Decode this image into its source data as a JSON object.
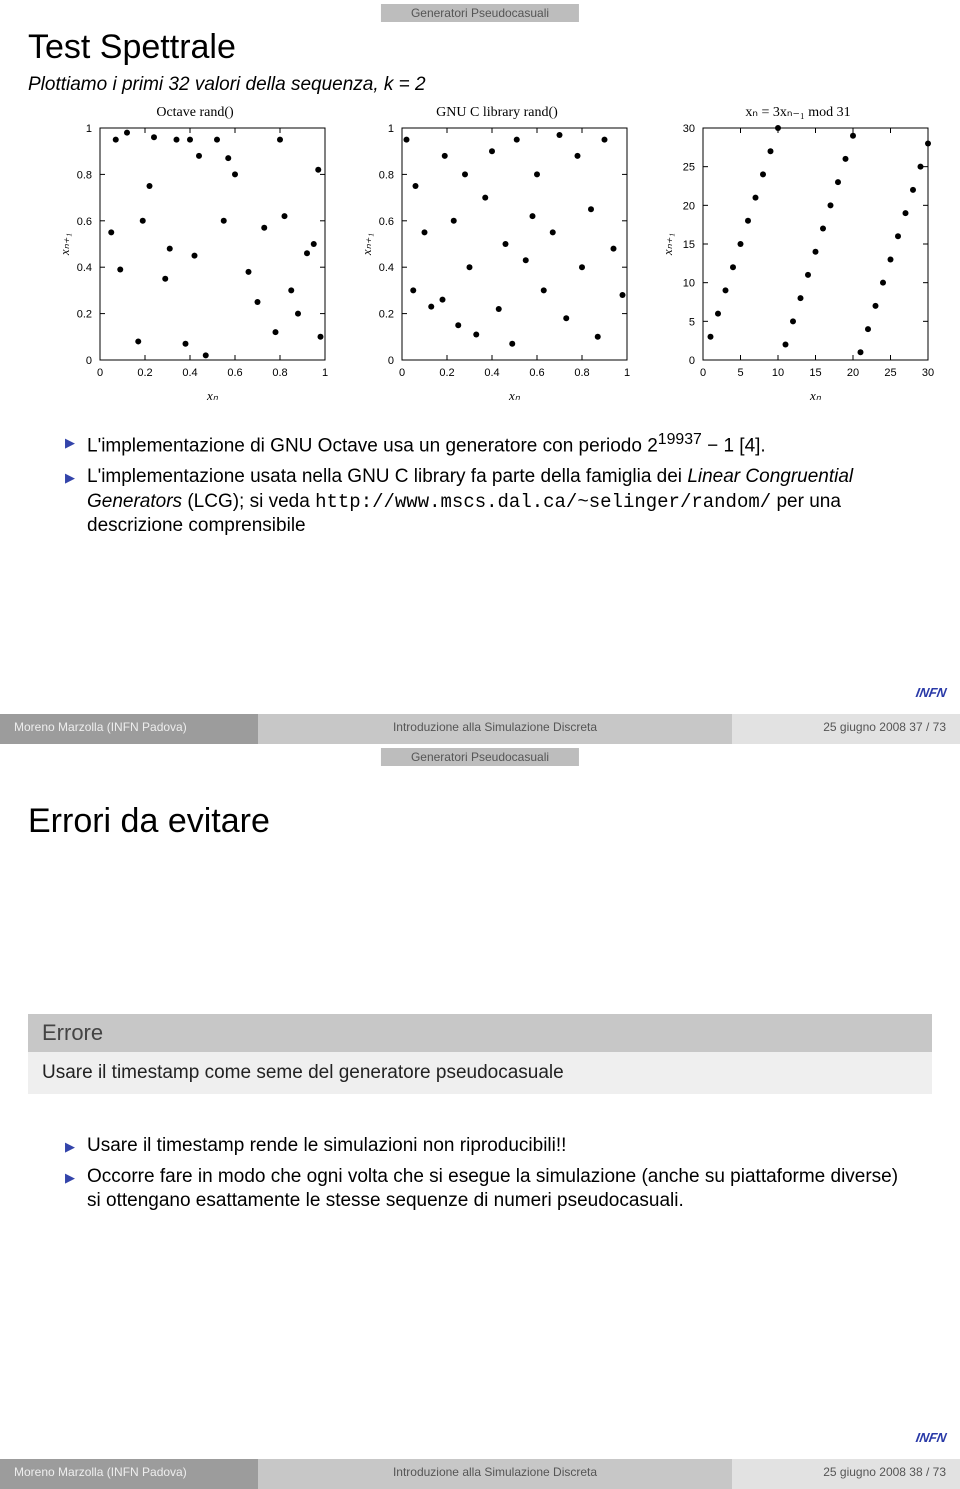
{
  "crumb": "Generatori Pseudocasuali",
  "slide1": {
    "title": "Test Spettrale",
    "subtitle_before": "Plottiamo i primi 32 valori della sequenza, ",
    "subtitle_math": "k = 2",
    "bullet1_a": "L'implementazione di GNU Octave usa un generatore con periodo 2",
    "bullet1_exp": "19937",
    "bullet1_b": " − 1 [4].",
    "bullet2_a": "L'implementazione usata nella GNU C library fa parte della famiglia dei ",
    "bullet2_em": "Linear Congruential Generators",
    "bullet2_b": " (LCG); si veda ",
    "bullet2_url": "http://www.mscs.dal.ca/~selinger/random/",
    "bullet2_c": " per una descrizione comprensibile",
    "footer_left": "Moreno Marzolla (INFN Padova)",
    "footer_mid": "Introduzione alla Simulazione Discreta",
    "footer_right": "25 giugno 2008    37 / 73"
  },
  "slide2": {
    "title": "Errori da evitare",
    "error_head": "Errore",
    "error_body": "Usare il timestamp come seme del generatore pseudocasuale",
    "bullet1": "Usare il timestamp rende le simulazioni non riproducibili!!",
    "bullet2": "Occorre fare in modo che ogni volta che si esegue la simulazione (anche su piattaforme diverse) si ottengano esattamente le stesse sequenze di numeri pseudocasuali.",
    "footer_left": "Moreno Marzolla (INFN Padova)",
    "footer_mid": "Introduzione alla Simulazione Discreta",
    "footer_right": "25 giugno 2008    38 / 73"
  },
  "logo_text": "INFN",
  "chart_data": [
    {
      "type": "scatter",
      "title": "Octave rand()",
      "xlabel": "xₙ",
      "ylabel": "xₙ₊₁",
      "xlim": [
        0,
        1
      ],
      "ylim": [
        0,
        1
      ],
      "xticks": [
        0,
        0.2,
        0.4,
        0.6,
        0.8,
        1
      ],
      "yticks": [
        0,
        0.2,
        0.4,
        0.6,
        0.8,
        1
      ],
      "points": [
        [
          0.05,
          0.55
        ],
        [
          0.07,
          0.95
        ],
        [
          0.09,
          0.39
        ],
        [
          0.12,
          0.98
        ],
        [
          0.17,
          0.08
        ],
        [
          0.19,
          0.6
        ],
        [
          0.22,
          0.75
        ],
        [
          0.24,
          0.96
        ],
        [
          0.29,
          0.35
        ],
        [
          0.31,
          0.48
        ],
        [
          0.34,
          0.95
        ],
        [
          0.38,
          0.07
        ],
        [
          0.4,
          0.95
        ],
        [
          0.42,
          0.45
        ],
        [
          0.44,
          0.88
        ],
        [
          0.47,
          0.02
        ],
        [
          0.52,
          0.95
        ],
        [
          0.55,
          0.6
        ],
        [
          0.57,
          0.87
        ],
        [
          0.6,
          0.8
        ],
        [
          0.66,
          0.38
        ],
        [
          0.7,
          0.25
        ],
        [
          0.73,
          0.57
        ],
        [
          0.78,
          0.12
        ],
        [
          0.8,
          0.95
        ],
        [
          0.82,
          0.62
        ],
        [
          0.85,
          0.3
        ],
        [
          0.88,
          0.2
        ],
        [
          0.92,
          0.46
        ],
        [
          0.95,
          0.5
        ],
        [
          0.97,
          0.82
        ],
        [
          0.98,
          0.1
        ]
      ]
    },
    {
      "type": "scatter",
      "title": "GNU C library rand()",
      "xlabel": "xₙ",
      "ylabel": "xₙ₊₁",
      "xlim": [
        0,
        1
      ],
      "ylim": [
        0,
        1
      ],
      "xticks": [
        0,
        0.2,
        0.4,
        0.6,
        0.8,
        1
      ],
      "yticks": [
        0,
        0.2,
        0.4,
        0.6,
        0.8,
        1
      ],
      "points": [
        [
          0.02,
          0.95
        ],
        [
          0.05,
          0.3
        ],
        [
          0.06,
          0.75
        ],
        [
          0.1,
          0.55
        ],
        [
          0.13,
          0.23
        ],
        [
          0.18,
          0.26
        ],
        [
          0.19,
          0.88
        ],
        [
          0.23,
          0.6
        ],
        [
          0.25,
          0.15
        ],
        [
          0.28,
          0.8
        ],
        [
          0.3,
          0.4
        ],
        [
          0.33,
          0.11
        ],
        [
          0.37,
          0.7
        ],
        [
          0.4,
          0.9
        ],
        [
          0.43,
          0.22
        ],
        [
          0.46,
          0.5
        ],
        [
          0.49,
          0.07
        ],
        [
          0.51,
          0.95
        ],
        [
          0.55,
          0.43
        ],
        [
          0.58,
          0.62
        ],
        [
          0.6,
          0.8
        ],
        [
          0.63,
          0.3
        ],
        [
          0.67,
          0.55
        ],
        [
          0.7,
          0.97
        ],
        [
          0.73,
          0.18
        ],
        [
          0.78,
          0.88
        ],
        [
          0.8,
          0.4
        ],
        [
          0.84,
          0.65
        ],
        [
          0.87,
          0.1
        ],
        [
          0.9,
          0.95
        ],
        [
          0.94,
          0.48
        ],
        [
          0.98,
          0.28
        ]
      ]
    },
    {
      "type": "scatter",
      "title": "xₙ = 3xₙ₋₁ mod 31",
      "xlabel": "xₙ",
      "ylabel": "xₙ₊₁",
      "xlim": [
        0,
        30
      ],
      "ylim": [
        0,
        30
      ],
      "xticks": [
        0,
        5,
        10,
        15,
        20,
        25,
        30
      ],
      "yticks": [
        0,
        5,
        10,
        15,
        20,
        25,
        30
      ],
      "points": [
        [
          1,
          3
        ],
        [
          3,
          9
        ],
        [
          9,
          27
        ],
        [
          27,
          19
        ],
        [
          19,
          26
        ],
        [
          26,
          16
        ],
        [
          16,
          17
        ],
        [
          17,
          20
        ],
        [
          20,
          29
        ],
        [
          29,
          25
        ],
        [
          25,
          13
        ],
        [
          13,
          8
        ],
        [
          8,
          24
        ],
        [
          24,
          10
        ],
        [
          10,
          30
        ],
        [
          30,
          28
        ],
        [
          28,
          22
        ],
        [
          22,
          4
        ],
        [
          4,
          12
        ],
        [
          12,
          5
        ],
        [
          5,
          15
        ],
        [
          15,
          14
        ],
        [
          14,
          11
        ],
        [
          11,
          2
        ],
        [
          2,
          6
        ],
        [
          6,
          18
        ],
        [
          18,
          23
        ],
        [
          23,
          7
        ],
        [
          7,
          21
        ],
        [
          21,
          1
        ]
      ]
    }
  ]
}
